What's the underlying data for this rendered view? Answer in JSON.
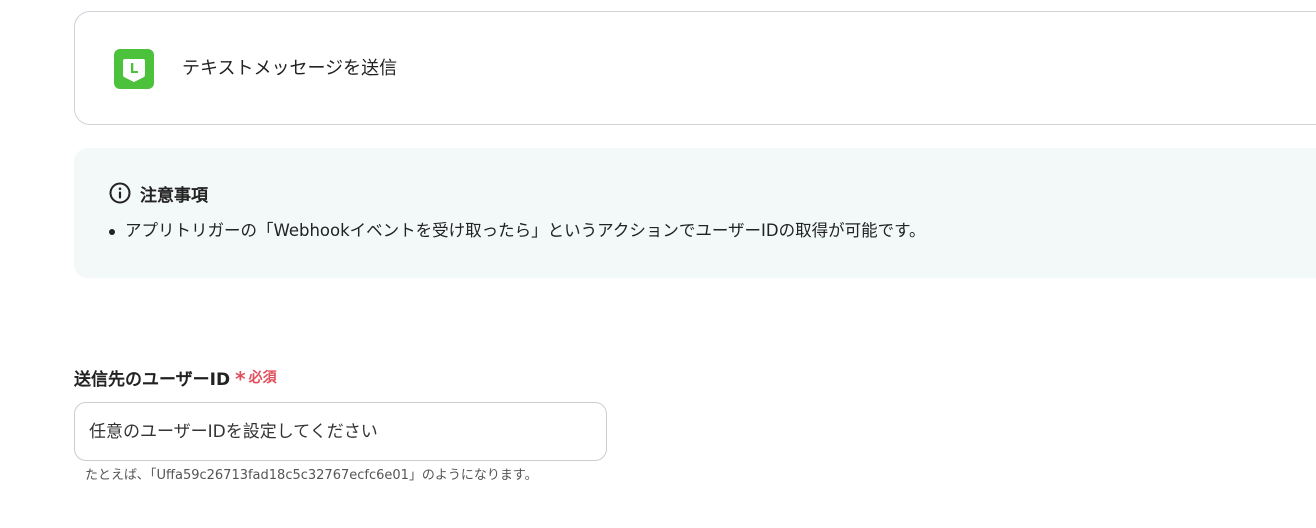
{
  "action": {
    "icon": "line-app-icon",
    "title": "テキストメッセージを送信",
    "icon_color": "#4cc13c"
  },
  "notice": {
    "icon": "info-icon",
    "title": "注意事項",
    "items": [
      "アプリトリガーの「Webhookイベントを受け取ったら」というアクションでユーザーIDの取得が可能です。"
    ],
    "background": "#f3f8f8"
  },
  "field": {
    "label": "送信先のユーザーID",
    "required_mark": "*",
    "required_text": "必須",
    "required_color": "#e0505c",
    "value": "",
    "placeholder": "任意のユーザーIDを設定してください",
    "help": "たとえば､「Uffa59c26713fad18c5c32767ecfc6e01」のようになります。"
  }
}
